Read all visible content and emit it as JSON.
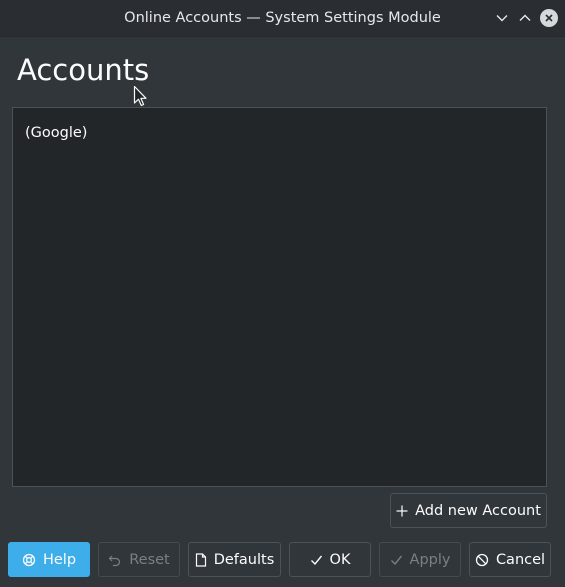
{
  "window": {
    "title": "Online Accounts — System Settings Module"
  },
  "page": {
    "title": "Accounts"
  },
  "accounts": {
    "items": [
      {
        "label": "(Google)"
      }
    ]
  },
  "actions": {
    "add_account_label": "Add new Account"
  },
  "footer": {
    "help_label": "Help",
    "reset_label": "Reset",
    "defaults_label": "Defaults",
    "ok_label": "OK",
    "apply_label": "Apply",
    "cancel_label": "Cancel"
  },
  "icons": {
    "minimize": "chevron-down-icon",
    "maximize": "chevron-up-icon",
    "close": "close-icon",
    "add": "plus-icon",
    "help": "help-icon",
    "reset": "undo-icon",
    "defaults": "document-icon",
    "ok": "check-icon",
    "apply": "check-icon",
    "cancel": "cancel-icon"
  },
  "colors": {
    "accent": "#3daee9",
    "window_bg": "#31363b",
    "list_bg": "#232629",
    "text": "#fcfcfc",
    "disabled_text": "#7b7f84"
  }
}
